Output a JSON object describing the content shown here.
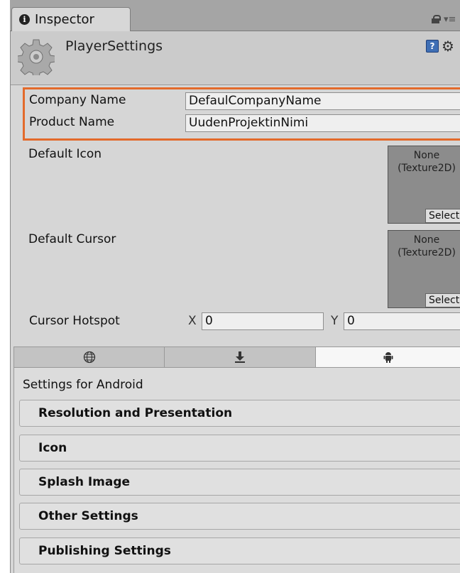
{
  "tab": {
    "label": "Inspector",
    "icon": "info-icon"
  },
  "header": {
    "title": "PlayerSettings"
  },
  "fields": {
    "company_name": {
      "label": "Company Name",
      "value": "DefaulCompanyName"
    },
    "product_name": {
      "label": "Product Name",
      "value": "UudenProjektinNimi"
    },
    "default_icon": {
      "label": "Default Icon",
      "slot_text": "None\n(Texture2D)",
      "select": "Select"
    },
    "default_cursor": {
      "label": "Default Cursor",
      "slot_text": "None\n(Texture2D)",
      "select": "Select"
    },
    "cursor_hotspot": {
      "label": "Cursor Hotspot",
      "x_label": "X",
      "x_value": "0",
      "y_label": "Y",
      "y_value": "0"
    }
  },
  "platform_tabs": [
    {
      "icon": "globe-icon",
      "active": false
    },
    {
      "icon": "download-icon",
      "active": false
    },
    {
      "icon": "android-icon",
      "active": true
    }
  ],
  "settings_for": "Settings for Android",
  "sections": [
    "Resolution and Presentation",
    "Icon",
    "Splash Image",
    "Other Settings",
    "Publishing Settings"
  ],
  "colors": {
    "highlight": "#e36a2b",
    "panel": "#d6d6d6"
  }
}
